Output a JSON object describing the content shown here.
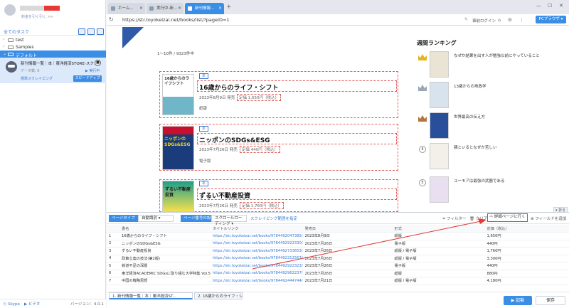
{
  "left": {
    "upgrade_text": "料金を引く引く >>",
    "all_tasks": "全てのタスク",
    "folders": [
      {
        "label": "test"
      },
      {
        "label": "Samples"
      },
      {
        "label": "デフォルト"
      }
    ],
    "task": {
      "name": "新刊情報一覧｜本｜東洋経済STORE-スク...",
      "data_label": "データ数: 0",
      "exec_label": "▶ 実行中",
      "mode": "標準スクレイピング",
      "speed_button": "スピードアップ"
    },
    "footer": {
      "skype": "Skype",
      "video": "ビデオ",
      "version": "バージョン：4.0.1"
    }
  },
  "tabs": [
    {
      "label": "ホーム..."
    },
    {
      "label": "実行中-新..."
    },
    {
      "label": "新刊情報..."
    }
  ],
  "address": {
    "url": "https://str.toyokeizai.net/books/list/?pageID=1",
    "prelogin": "事前ログイン",
    "pc_browser": "PCブラウザ"
  },
  "page": {
    "count": "1〜10件 / 9323件中",
    "books": [
      {
        "tag": "本",
        "title": "16歳からのライフ・シフト",
        "date": "2023年8月9日 発売",
        "price": "定価 1,650円（税込）",
        "form": "紙版",
        "cover_text": "16歳からのライフシフト"
      },
      {
        "tag": "本",
        "title": "ニッポンのSDGs&ESG",
        "date": "2023年7月26日 発売",
        "price": "定価 440円（税込）",
        "form": "電子版",
        "cover_text": "ニッポンのSDGs&ESG"
      },
      {
        "tag": "本",
        "title": "ずるい不動産投資",
        "date": "2023年7月26日 発売",
        "price": "定価 1,760円（税込）",
        "form": "",
        "cover_text": "ずるい不動産投資"
      }
    ],
    "ranking": {
      "title": "週間ランキング",
      "items": [
        {
          "rank": "1",
          "title": "なぜか結果を出す人が勉強以前にやっていること"
        },
        {
          "rank": "2",
          "title": "13歳からの地政学"
        },
        {
          "rank": "3",
          "title": "世界最高の伝え方"
        },
        {
          "rank": "4",
          "title": "親といるとなぜか苦しい"
        },
        {
          "rank": "5",
          "title": "ユーモアは最強の武器である"
        }
      ]
    },
    "collapse": "折る"
  },
  "panel": {
    "page_type_label": "ページタイプ",
    "page_type_value": "自動識別",
    "page_num_label": "ページ番号の設定",
    "page_num_value": "スクロールローディング",
    "scrape_range": "スクレイピング範囲を指定",
    "filter": "フィルター",
    "clear": "クリア",
    "detail_button": "詳細ページに行く",
    "add_field": "フィールドを追加",
    "columns": [
      "",
      "書名",
      "タイトルリンク",
      "発売日",
      "形式",
      "定価（税込）"
    ],
    "rows": [
      [
        "1",
        "16歳からのライフ・シフト",
        "https://str.toyokeizai.net/books/9784492047385/",
        "2023年8月9日",
        "紙版",
        "1,650円"
      ],
      [
        "2",
        "ニッポンのSDGs&ESG",
        "https://str.toyokeizai.net/books/9784492922330/",
        "2023年7月26日",
        "電子版",
        "440円"
      ],
      [
        "3",
        "ずるい不動産投資",
        "https://str.toyokeizai.net/books/9784492733653/",
        "2023年7月26日",
        "紙版 / 電子版",
        "1,760円"
      ],
      [
        "4",
        "政策立案の技法(第2版)",
        "https://str.toyokeizai.net/books/9784492212567/",
        "2023年7月26日",
        "紙版 / 電子版",
        "3,300円"
      ],
      [
        "5",
        "鉄道不足の深層",
        "https://str.toyokeizai.net/books/9784492922323/",
        "2023年7月26日",
        "電子版",
        "440円"
      ],
      [
        "6",
        "東洋経済ACADEMIC SDGsに取り組む大学特集 Vol.5",
        "https://str.toyokeizai.net/books/9784492962237/",
        "2023年7月26日",
        "紙版",
        "880円"
      ],
      [
        "7",
        "中国の機略思想",
        "https://str.toyokeizai.net/books/9784492444744/",
        "2023年7月21日",
        "紙版 / 電子版",
        "4,180円"
      ]
    ],
    "bottom_tabs": [
      "1. 新刊情報一覧｜本｜東洋経済ST...",
      "2. 16歳からのライフ・シフト｜東..."
    ],
    "start_button": "起動",
    "save_button": "保存"
  }
}
